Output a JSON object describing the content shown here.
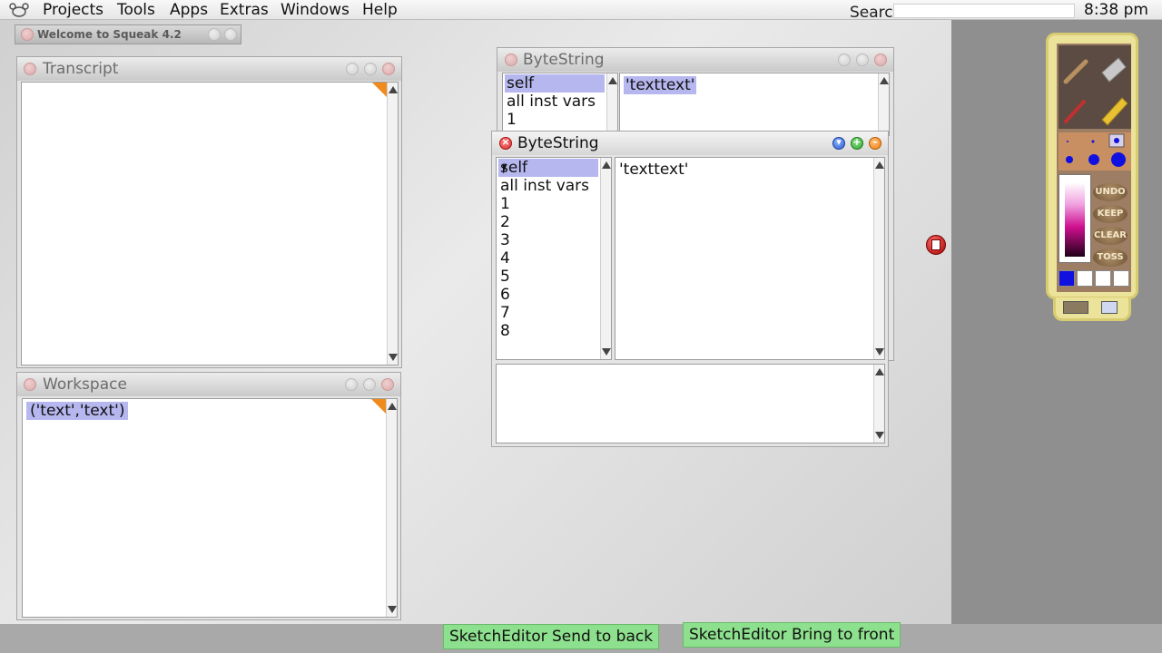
{
  "menubar": {
    "items": [
      "Projects",
      "Tools",
      "Apps",
      "Extras",
      "Windows",
      "Help"
    ],
    "search_label": "Search",
    "clock": "8:38 pm"
  },
  "welcome": {
    "title": "Welcome to Squeak 4.2"
  },
  "transcript": {
    "title": "Transcript"
  },
  "workspace": {
    "title": "Workspace",
    "text": "('text','text')"
  },
  "inspector_back": {
    "title": "ByteString",
    "fields": [
      "self",
      "all inst vars",
      "1"
    ],
    "value": "'texttext'"
  },
  "inspector_front": {
    "title": "ByteString",
    "fields": [
      "self",
      "all inst vars",
      "1",
      "2",
      "3",
      "4",
      "5",
      "6",
      "7",
      "8"
    ],
    "value": "'texttext'"
  },
  "palette": {
    "buttons": [
      "UNDO",
      "KEEP",
      "CLEAR",
      "TOSS"
    ],
    "colors": {
      "accent": "#1010e0",
      "frame": "#ece39a"
    }
  },
  "bottom": {
    "send_back": "SketchEditor Send to back",
    "bring_front": "SketchEditor Bring to front"
  }
}
